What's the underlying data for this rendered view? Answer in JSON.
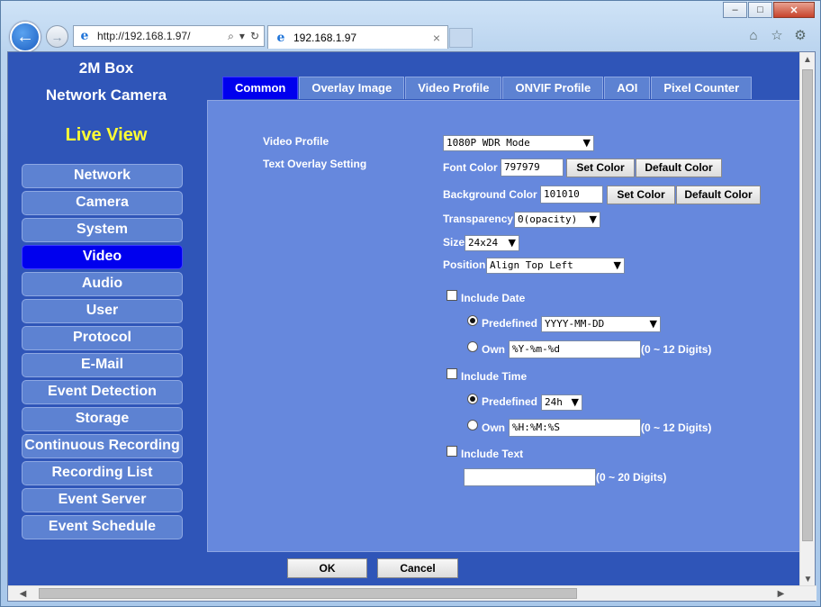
{
  "browser": {
    "url": "http://192.168.1.97/",
    "tab_title": "192.168.1.97",
    "tab_close": "×",
    "ie_glyph": "e",
    "back_glyph": "←",
    "forward_glyph": "→",
    "search_glyph": "⌕",
    "dropdown_glyph": "▾",
    "refresh_glyph": "↻",
    "home_glyph": "⌂",
    "favorites_glyph": "☆",
    "settings_glyph": "⚙",
    "minimize_glyph": "–",
    "maximize_glyph": "□",
    "close_glyph": "✕"
  },
  "sidebar": {
    "brand_line1": "2M Box",
    "brand_line2": "Network Camera",
    "live_view": "Live View",
    "items": [
      {
        "label": "Network"
      },
      {
        "label": "Camera"
      },
      {
        "label": "System"
      },
      {
        "label": "Video"
      },
      {
        "label": "Audio"
      },
      {
        "label": "User"
      },
      {
        "label": "Protocol"
      },
      {
        "label": "E-Mail"
      },
      {
        "label": "Event Detection"
      },
      {
        "label": "Storage"
      },
      {
        "label": "Continuous Recording"
      },
      {
        "label": "Recording List"
      },
      {
        "label": "Event Server"
      },
      {
        "label": "Event Schedule"
      }
    ],
    "active_index": 3
  },
  "tabs": [
    {
      "label": "Common"
    },
    {
      "label": "Overlay Image"
    },
    {
      "label": "Video Profile"
    },
    {
      "label": "ONVIF Profile"
    },
    {
      "label": "AOI"
    },
    {
      "label": "Pixel Counter"
    }
  ],
  "form": {
    "video_profile_label": "Video Profile",
    "video_profile_value": "1080P WDR Mode",
    "text_overlay_label": "Text Overlay Setting",
    "font_color_label": "Font Color",
    "font_color_value": "797979",
    "bg_color_label": "Background Color",
    "bg_color_value": "101010",
    "set_color": "Set Color",
    "default_color": "Default Color",
    "transparency_label": "Transparency",
    "transparency_value": "0(opacity)",
    "size_label": "Size",
    "size_value": "24x24",
    "position_label": "Position",
    "position_value": "Align Top Left",
    "include_date": "Include Date",
    "predefined": "Predefined",
    "date_format_value": "YYYY-MM-DD",
    "own": "Own",
    "date_own_value": "%Y-%m-%d",
    "digits_12": "(0 ~ 12 Digits)",
    "include_time": "Include Time",
    "time_format_value": "24h",
    "time_own_value": "%H:%M:%S",
    "include_text": "Include Text",
    "text_value": "",
    "digits_20": "(0 ~ 20 Digits)"
  },
  "footer": {
    "ok": "OK",
    "cancel": "Cancel"
  },
  "colors": {
    "page_bg": "#2f55b8",
    "panel_bg": "#6688dd",
    "active_item": "#0000ee",
    "live_view": "#ffff33"
  }
}
